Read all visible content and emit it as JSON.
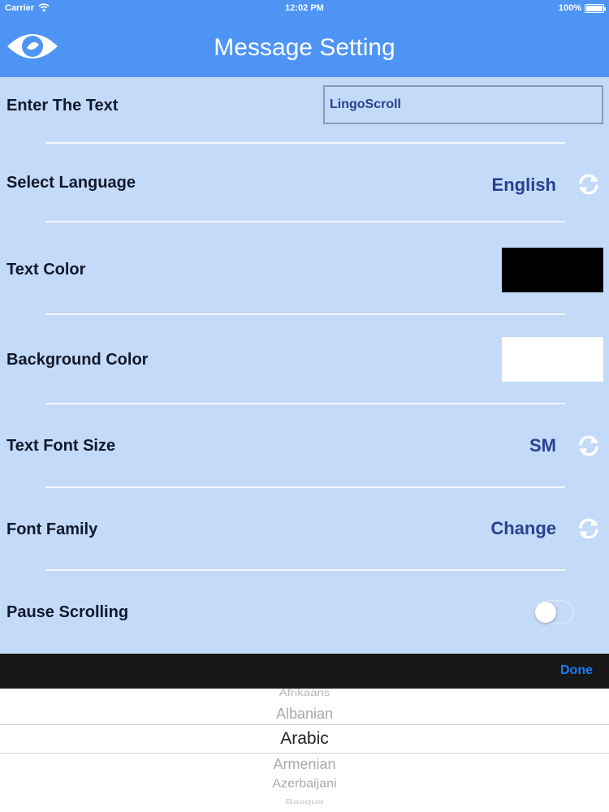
{
  "status": {
    "carrier": "Carrier",
    "time": "12:02 PM",
    "battery": "100%"
  },
  "nav": {
    "title": "Message Setting",
    "logo_icon": "eye-icon"
  },
  "colors": {
    "accent": "#4d94f5",
    "panel": "#c3daf9",
    "value_text": "#2b3f8e",
    "done": "#1a7cf2",
    "text_color_swatch": "#000000",
    "background_color_swatch": "#ffffff"
  },
  "settings": {
    "enter_text": {
      "label": "Enter The Text",
      "value": "LingoScroll"
    },
    "language": {
      "label": "Select Language",
      "value": "English"
    },
    "text_color": {
      "label": "Text Color"
    },
    "background_color": {
      "label": "Background Color"
    },
    "font_size": {
      "label": "Text Font Size",
      "value": "SM"
    },
    "font_family": {
      "label": "Font Family",
      "value": "Change"
    },
    "pause_scrolling": {
      "label": "Pause Scrolling",
      "on": false
    }
  },
  "toolbar": {
    "done_label": "Done"
  },
  "picker": {
    "items": [
      "Afrikaans",
      "Albanian",
      "Arabic",
      "Armenian",
      "Azerbaijani",
      "Basque"
    ],
    "selected": "Arabic"
  }
}
